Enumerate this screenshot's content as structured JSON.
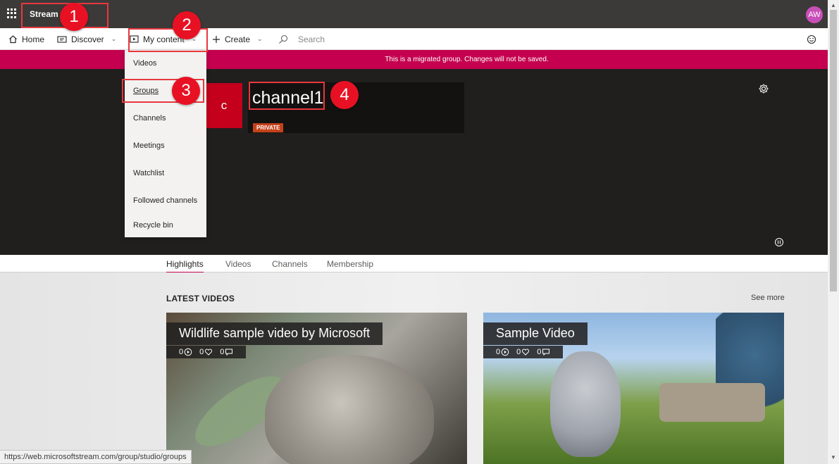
{
  "app": {
    "title": "Stream",
    "avatar_initials": "AW"
  },
  "nav": {
    "home": "Home",
    "discover": "Discover",
    "my_content": "My content",
    "create": "Create",
    "search_placeholder": "Search"
  },
  "banner": {
    "text": "This is a migrated group. Changes will not be saved."
  },
  "dropdown": {
    "items": [
      "Videos",
      "Groups",
      "Channels",
      "Meetings",
      "Watchlist",
      "Followed channels",
      "Recycle bin"
    ]
  },
  "channel": {
    "tile_letter": "c",
    "name": "channel1",
    "badge": "PRIVATE"
  },
  "tabs": [
    "Highlights",
    "Videos",
    "Channels",
    "Membership"
  ],
  "latest": {
    "title": "LATEST VIDEOS",
    "see_more": "See more",
    "videos": [
      {
        "title": "Wildlife sample video by Microsoft",
        "views": "0",
        "likes": "0",
        "comments": "0"
      },
      {
        "title": "Sample Video",
        "views": "0",
        "likes": "0",
        "comments": "0"
      }
    ]
  },
  "status_url": "https://web.microsoftstream.com/group/studio/groups",
  "callouts": [
    "1",
    "2",
    "3",
    "4"
  ],
  "colors": {
    "accent": "#c4004f",
    "callout": "#e81123",
    "topbar": "#3b3a39"
  }
}
